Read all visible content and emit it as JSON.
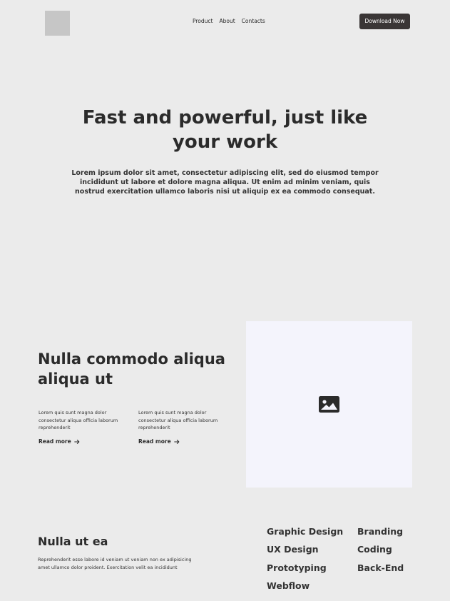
{
  "header": {
    "nav": [
      "Product",
      "About",
      "Contacts"
    ],
    "cta_label": "Download Now"
  },
  "hero": {
    "title": "Fast and powerful, just like your work",
    "subtitle": "Lorem ipsum dolor sit amet, consectetur adipiscing elit, sed do eiusmod tempor incididunt ut labore et dolore magna aliqua. Ut enim ad minim veniam, quis nostrud exercitation ullamco laboris nisi ut aliquip ex ea commodo consequat."
  },
  "features": {
    "title": "Nulla commodo aliqua aliqua ut",
    "cards": [
      {
        "text": "Lorem quis sunt magna dolor consectetur aliqua officia laborum reprehenderit",
        "link": "Read more"
      },
      {
        "text": "Lorem quis sunt magna dolor consectetur aliqua officia laborum reprehenderit",
        "link": "Read more"
      }
    ],
    "image_icon": "image-icon"
  },
  "bottom": {
    "title": "Nulla ut ea",
    "text": "Reprehenderit esse labore id veniam ut veniam non ex adipisicing amet ullamco dolor proident. Exercitation velit ea incididunt",
    "services": [
      "Graphic Design",
      "Branding",
      "UX Design",
      "Coding",
      "Prototyping",
      "Back-End",
      "Webflow"
    ]
  },
  "colors": {
    "background": "#ebebeb",
    "button": "#3a3636",
    "logo_placeholder": "#c6c6c6",
    "image_placeholder": "#f4f4fc",
    "text": "#2b2b2b"
  }
}
